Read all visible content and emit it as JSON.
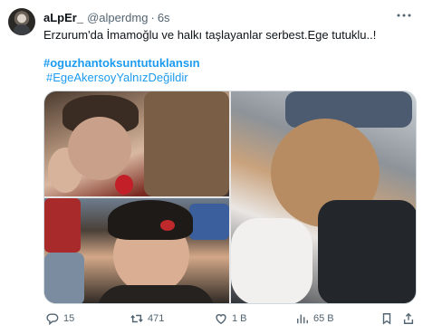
{
  "tweet": {
    "display_name": "aLpEr_",
    "handle": "@alperdmg",
    "separator": "·",
    "time": "6s",
    "text": "Erzurum'da İmamoğlu ve halkı taşlayanlar serbest.Ege tutuklu..!",
    "hashtags": [
      "#oguzhantoksuntutuklansın",
      "#EgeAkersoyYalnızDeğildir"
    ]
  },
  "media": {
    "photos": [
      "photo-injured-boy",
      "photo-woman-on-ground",
      "photo-boy-head-wound"
    ]
  },
  "actions": {
    "replies": "15",
    "reposts": "471",
    "likes": "1 B",
    "views": "65 B"
  },
  "colors": {
    "link": "#1d9bf0",
    "secondary_text": "#536471",
    "border": "#cfd9de"
  },
  "icons": [
    "more-icon",
    "reply-icon",
    "repost-icon",
    "like-icon",
    "views-icon",
    "bookmark-icon",
    "share-icon"
  ]
}
